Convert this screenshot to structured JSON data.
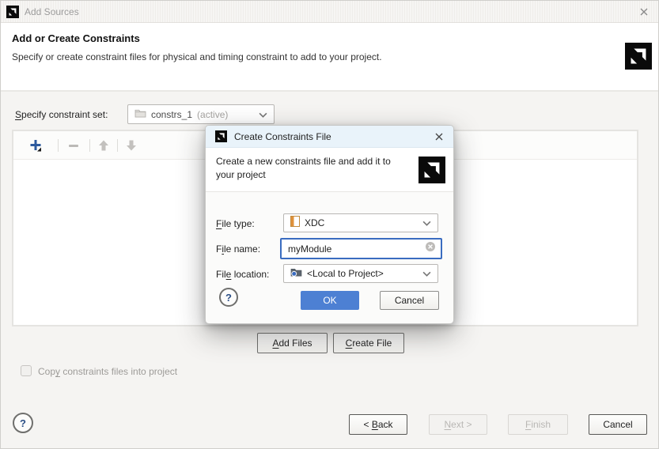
{
  "window": {
    "title": "Add Sources"
  },
  "header": {
    "title": "Add or Create Constraints",
    "description": "Specify or create constraint files for physical and timing constraint to add to your project."
  },
  "constraint_set": {
    "label": {
      "text": "Specify constraint set:",
      "u": 0
    },
    "value": "constrs_1",
    "status": "(active)"
  },
  "toolbar": {
    "icons": [
      "add-constraint-file",
      "remove-file",
      "move-up",
      "move-down"
    ]
  },
  "actions": {
    "add_files": {
      "text": "Add Files",
      "u": 0
    },
    "create_file": {
      "text": "Create File",
      "u": 0
    }
  },
  "options": {
    "copy_files": {
      "text": "Copy constraints files into project",
      "u": 3
    },
    "copy_files_checked": false
  },
  "wizard_footer": {
    "help": "?",
    "back": {
      "text": "< Back",
      "u": 2
    },
    "next": {
      "text": "Next >",
      "u": 0
    },
    "finish": {
      "text": "Finish",
      "u": 0
    },
    "cancel": "Cancel"
  },
  "dialog": {
    "title": "Create Constraints File",
    "description": "Create a new constraints file and add it to your project",
    "file_type": {
      "label": {
        "text": "File type:",
        "u": 0
      },
      "value": "XDC"
    },
    "file_name": {
      "label": {
        "text": "File name:",
        "u": 1
      },
      "value": "myModule"
    },
    "file_location": {
      "label": {
        "text": "File location:",
        "u": 3
      },
      "value": "<Local to Project>"
    },
    "help": "?",
    "ok": "OK",
    "cancel": "Cancel"
  },
  "colors": {
    "primary_button": "#4d80d3",
    "focus_border": "#3a6cc0",
    "dialog_titlebar": "#e9f3fa"
  }
}
